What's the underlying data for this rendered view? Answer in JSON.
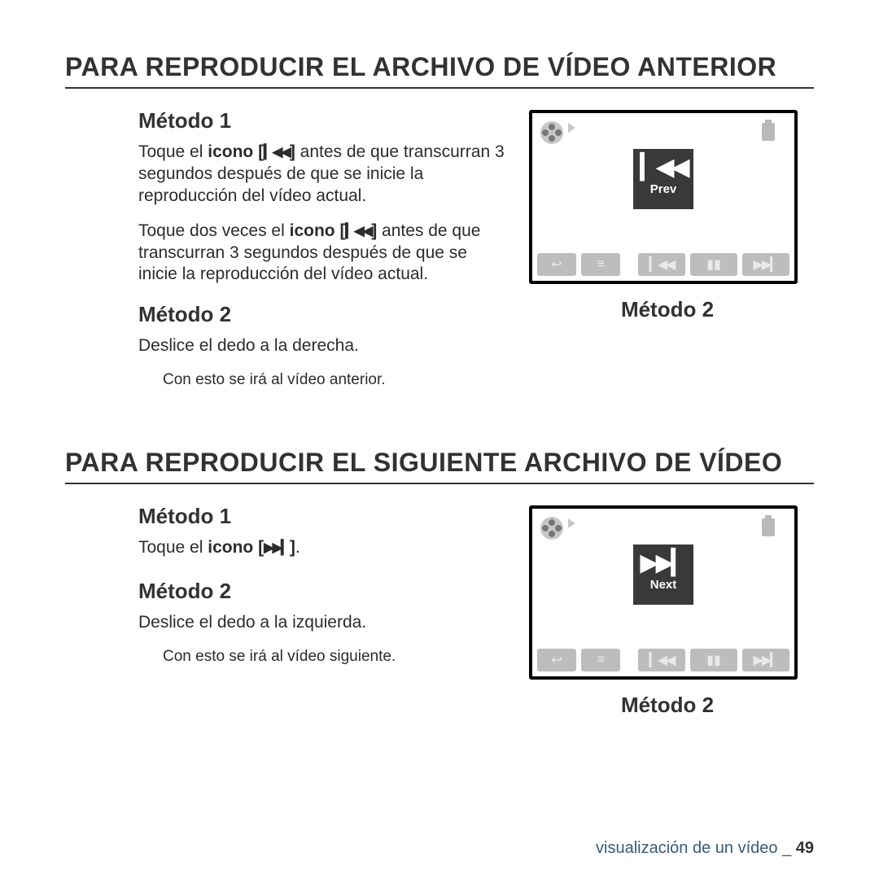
{
  "section_a": {
    "title": "PARA REPRODUCIR EL ARCHIVO DE VÍDEO ANTERIOR",
    "m1_h": "Método 1",
    "m1_p1a": "Toque el ",
    "m1_p1b": "icono [",
    "m1_p1c": "]",
    "m1_p1d": " antes de que transcurran 3 segundos después de que se inicie la reproducción del vídeo actual.",
    "m1_p2a": "Toque dos veces el ",
    "m1_p2b": "icono [",
    "m1_p2c": "]",
    "m1_p2d": " antes de que transcurran 3 segundos después de que se inicie la reproducción del vídeo actual.",
    "m2_h": "Método 2",
    "m2_p": "Deslice el dedo a la derecha.",
    "m2_sub": "Con esto se irá al vídeo anterior.",
    "screen_label": "Prev",
    "screen_glyph": "▎◀◀",
    "right_cap": "Método 2"
  },
  "section_b": {
    "title": "PARA REPRODUCIR EL SIGUIENTE ARCHIVO DE VÍDEO",
    "m1_h": "Método 1",
    "m1_p_a": "Toque el ",
    "m1_p_b": "icono [",
    "m1_p_c": "]",
    "m1_p_d": ".",
    "m2_h": "Método 2",
    "m2_p": "Deslice el dedo a la izquierda.",
    "m2_sub": "Con esto se irá al vídeo siguiente.",
    "screen_label": "Next",
    "screen_glyph": "▶▶▎",
    "right_cap": "Método 2"
  },
  "icons": {
    "prev": "▎◀◀",
    "next": "▶▶▎"
  },
  "footer": {
    "text": "visualización de un vídeo _ ",
    "page": "49"
  }
}
